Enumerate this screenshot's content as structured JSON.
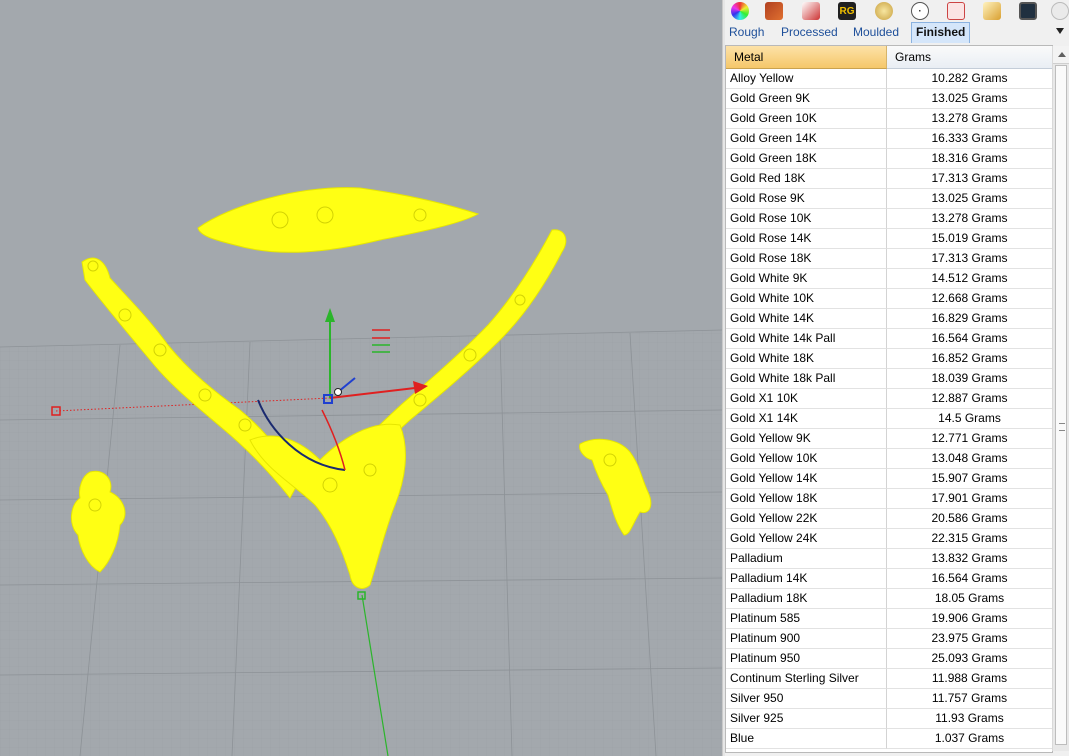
{
  "toolbar": {
    "icons": [
      "color-wheel-icon",
      "render-icon",
      "paint-brush-icon",
      "rg-icon",
      "gem-icon",
      "clock-icon",
      "cup-icon",
      "material-icon",
      "monitor-icon",
      "settings-icon"
    ],
    "rg_text": "RG"
  },
  "tabs": [
    {
      "label": "Rough",
      "active": false
    },
    {
      "label": "Processed",
      "active": false
    },
    {
      "label": "Moulded",
      "active": false
    },
    {
      "label": "Finished",
      "active": true
    }
  ],
  "table": {
    "headers": {
      "metal": "Metal",
      "grams": "Grams"
    },
    "rows": [
      {
        "metal": "Alloy Yellow",
        "grams": "10.282 Grams"
      },
      {
        "metal": "Gold Green 9K",
        "grams": "13.025 Grams"
      },
      {
        "metal": "Gold Green 10K",
        "grams": "13.278 Grams"
      },
      {
        "metal": "Gold Green 14K",
        "grams": "16.333 Grams"
      },
      {
        "metal": "Gold Green 18K",
        "grams": "18.316 Grams"
      },
      {
        "metal": "Gold Red 18K",
        "grams": "17.313 Grams"
      },
      {
        "metal": "Gold Rose 9K",
        "grams": "13.025 Grams"
      },
      {
        "metal": "Gold Rose 10K",
        "grams": "13.278 Grams"
      },
      {
        "metal": "Gold Rose 14K",
        "grams": "15.019 Grams"
      },
      {
        "metal": "Gold Rose 18K",
        "grams": "17.313 Grams"
      },
      {
        "metal": "Gold White 9K",
        "grams": "14.512 Grams"
      },
      {
        "metal": "Gold White 10K",
        "grams": "12.668 Grams"
      },
      {
        "metal": "Gold White 14K",
        "grams": "16.829 Grams"
      },
      {
        "metal": "Gold White 14k Pall",
        "grams": "16.564 Grams"
      },
      {
        "metal": "Gold White 18K",
        "grams": "16.852 Grams"
      },
      {
        "metal": "Gold White 18k Pall",
        "grams": "18.039 Grams"
      },
      {
        "metal": "Gold X1 10K",
        "grams": "12.887 Grams"
      },
      {
        "metal": "Gold X1 14K",
        "grams": "14.5 Grams"
      },
      {
        "metal": "Gold Yellow 9K",
        "grams": "12.771 Grams"
      },
      {
        "metal": "Gold Yellow 10K",
        "grams": "13.048 Grams"
      },
      {
        "metal": "Gold Yellow 14K",
        "grams": "15.907 Grams"
      },
      {
        "metal": "Gold Yellow 18K",
        "grams": "17.901 Grams"
      },
      {
        "metal": "Gold Yellow 22K",
        "grams": "20.586 Grams"
      },
      {
        "metal": "Gold Yellow 24K",
        "grams": "22.315 Grams"
      },
      {
        "metal": "Palladium",
        "grams": "13.832 Grams"
      },
      {
        "metal": "Palladium 14K",
        "grams": "16.564 Grams"
      },
      {
        "metal": "Palladium 18K",
        "grams": "18.05 Grams"
      },
      {
        "metal": "Platinum 585",
        "grams": "19.906 Grams"
      },
      {
        "metal": "Platinum 900",
        "grams": "23.975 Grams"
      },
      {
        "metal": "Platinum 950",
        "grams": "25.093 Grams"
      },
      {
        "metal": "Continum Sterling Silver",
        "grams": "11.988 Grams"
      },
      {
        "metal": "Silver 950",
        "grams": "11.757 Grams"
      },
      {
        "metal": "Silver 925",
        "grams": "11.93 Grams"
      },
      {
        "metal": "Blue",
        "grams": "1.037 Grams"
      }
    ]
  },
  "viewport": {
    "background": "#a3a8ad",
    "jewelry_color": "#ffff14",
    "axis_x_color": "#e02020",
    "axis_y_color": "#2bb52b",
    "axis_z_color": "#2040d0"
  }
}
